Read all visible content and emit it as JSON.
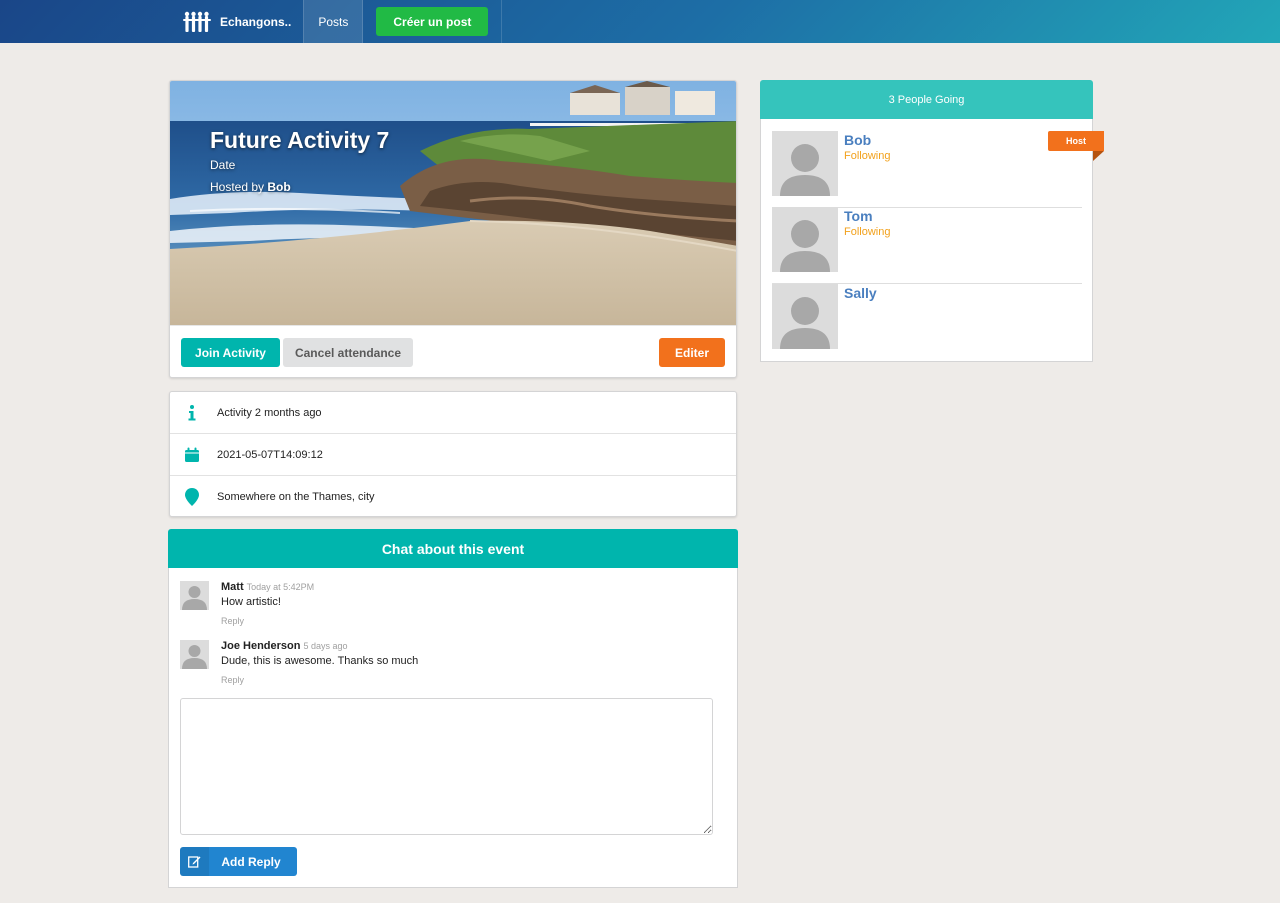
{
  "navbar": {
    "brand": "Echangons..",
    "posts_label": "Posts",
    "create_label": "Créer un post"
  },
  "activity": {
    "title": "Future Activity 7",
    "date_label": "Date",
    "hosted_prefix": "Hosted by ",
    "host_name": "Bob",
    "join_label": "Join Activity",
    "cancel_label": "Cancel attendance",
    "edit_label": "Editer"
  },
  "details": {
    "description": "Activity 2 months ago",
    "datetime": "2021-05-07T14:09:12",
    "venue": "Somewhere on the Thames, city"
  },
  "chat": {
    "title": "Chat about this event",
    "comments": [
      {
        "author": "Matt",
        "time": "Today at 5:42PM",
        "text": "How artistic!",
        "reply": "Reply"
      },
      {
        "author": "Joe Henderson",
        "time": "5 days ago",
        "text": "Dude, this is awesome. Thanks so much",
        "reply": "Reply"
      }
    ],
    "add_reply_label": "Add Reply"
  },
  "sidebar": {
    "title": "3 People Going",
    "host_badge": "Host",
    "attendees": [
      {
        "name": "Bob",
        "status": "Following"
      },
      {
        "name": "Tom",
        "status": "Following"
      },
      {
        "name": "Sally",
        "status": ""
      }
    ]
  },
  "colors": {
    "teal": "#00b5ad",
    "orange": "#f2711c",
    "blue": "#2185d0",
    "green": "#21ba45",
    "link_blue": "#4a7fbf",
    "following": "#f2a11c"
  }
}
